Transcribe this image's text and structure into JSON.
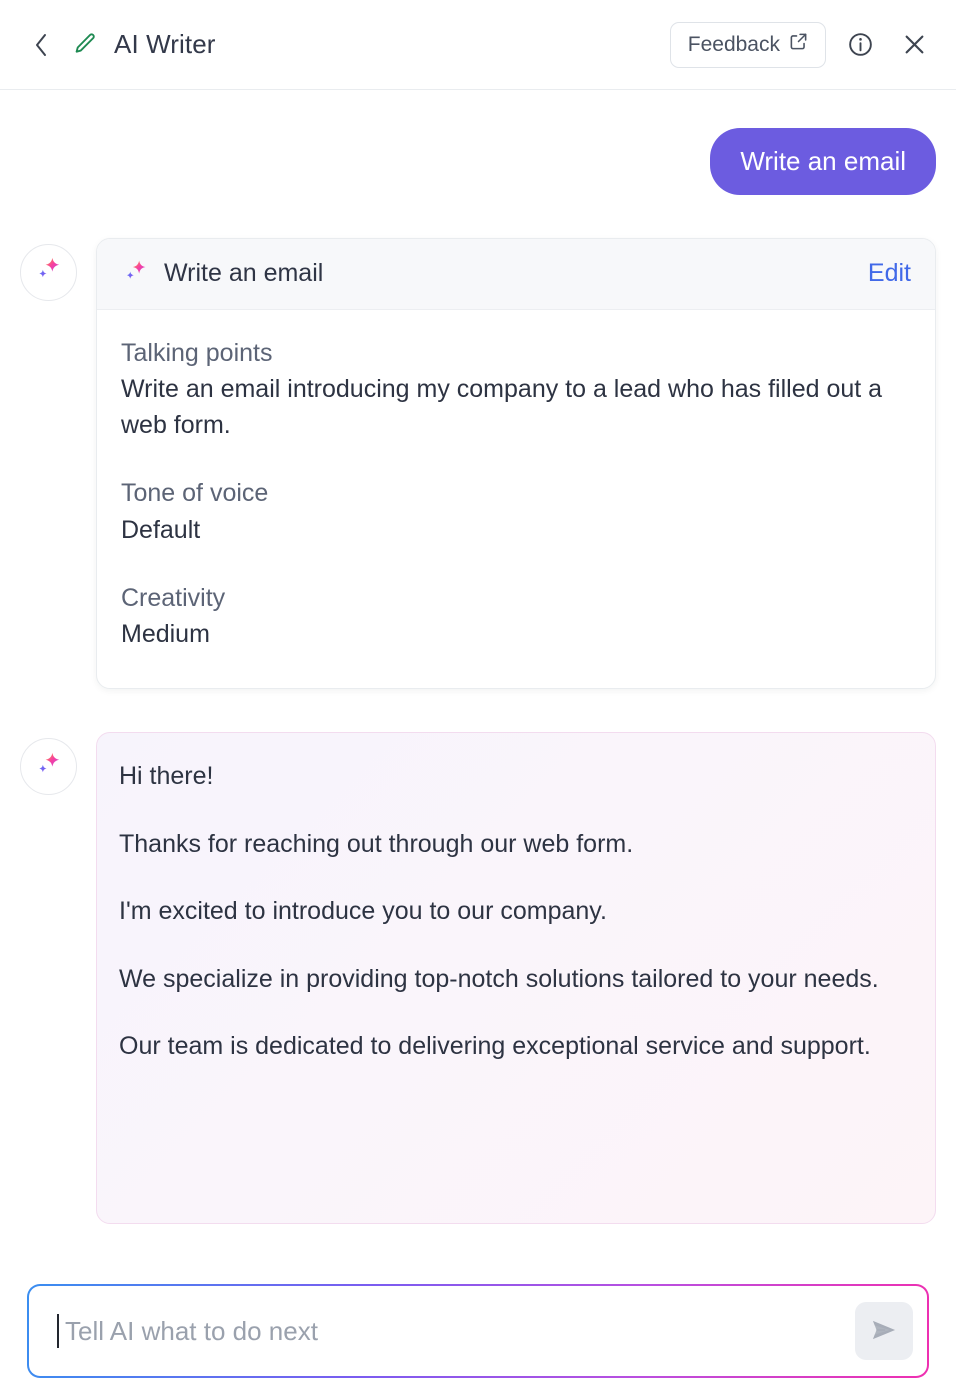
{
  "header": {
    "title": "AI Writer",
    "back_icon": "chevron-left-icon",
    "app_icon": "pencil-icon",
    "feedback_label": "Feedback",
    "feedback_icon": "external-link-icon",
    "info_icon": "info-circle-icon",
    "close_icon": "close-icon"
  },
  "conversation": {
    "user_message": "Write an email",
    "prompt_card": {
      "avatar_icon": "ai-sparkle-icon",
      "title_icon": "ai-sparkle-icon",
      "title": "Write an email",
      "edit_label": "Edit",
      "fields": [
        {
          "label": "Talking points",
          "value": "Write an email introducing my company to a lead who has filled out a web form."
        },
        {
          "label": "Tone of voice",
          "value": "Default"
        },
        {
          "label": "Creativity",
          "value": "Medium"
        }
      ]
    },
    "answer": {
      "avatar_icon": "ai-sparkle-icon",
      "paragraphs": [
        "Hi there!",
        "Thanks for reaching out through our web form.",
        "I'm excited to introduce you to our company.",
        "We specialize in providing top-notch solutions tailored to your needs.",
        "Our team is dedicated to delivering exceptional service and support."
      ]
    }
  },
  "composer": {
    "placeholder": "Tell AI what to do next",
    "value": "",
    "send_icon": "send-paper-plane-icon"
  },
  "colors": {
    "accent_purple": "#6c5ce0",
    "link_blue": "#4169e8",
    "pencil_green": "#1e8a52",
    "border_gray": "#e9ecef"
  }
}
